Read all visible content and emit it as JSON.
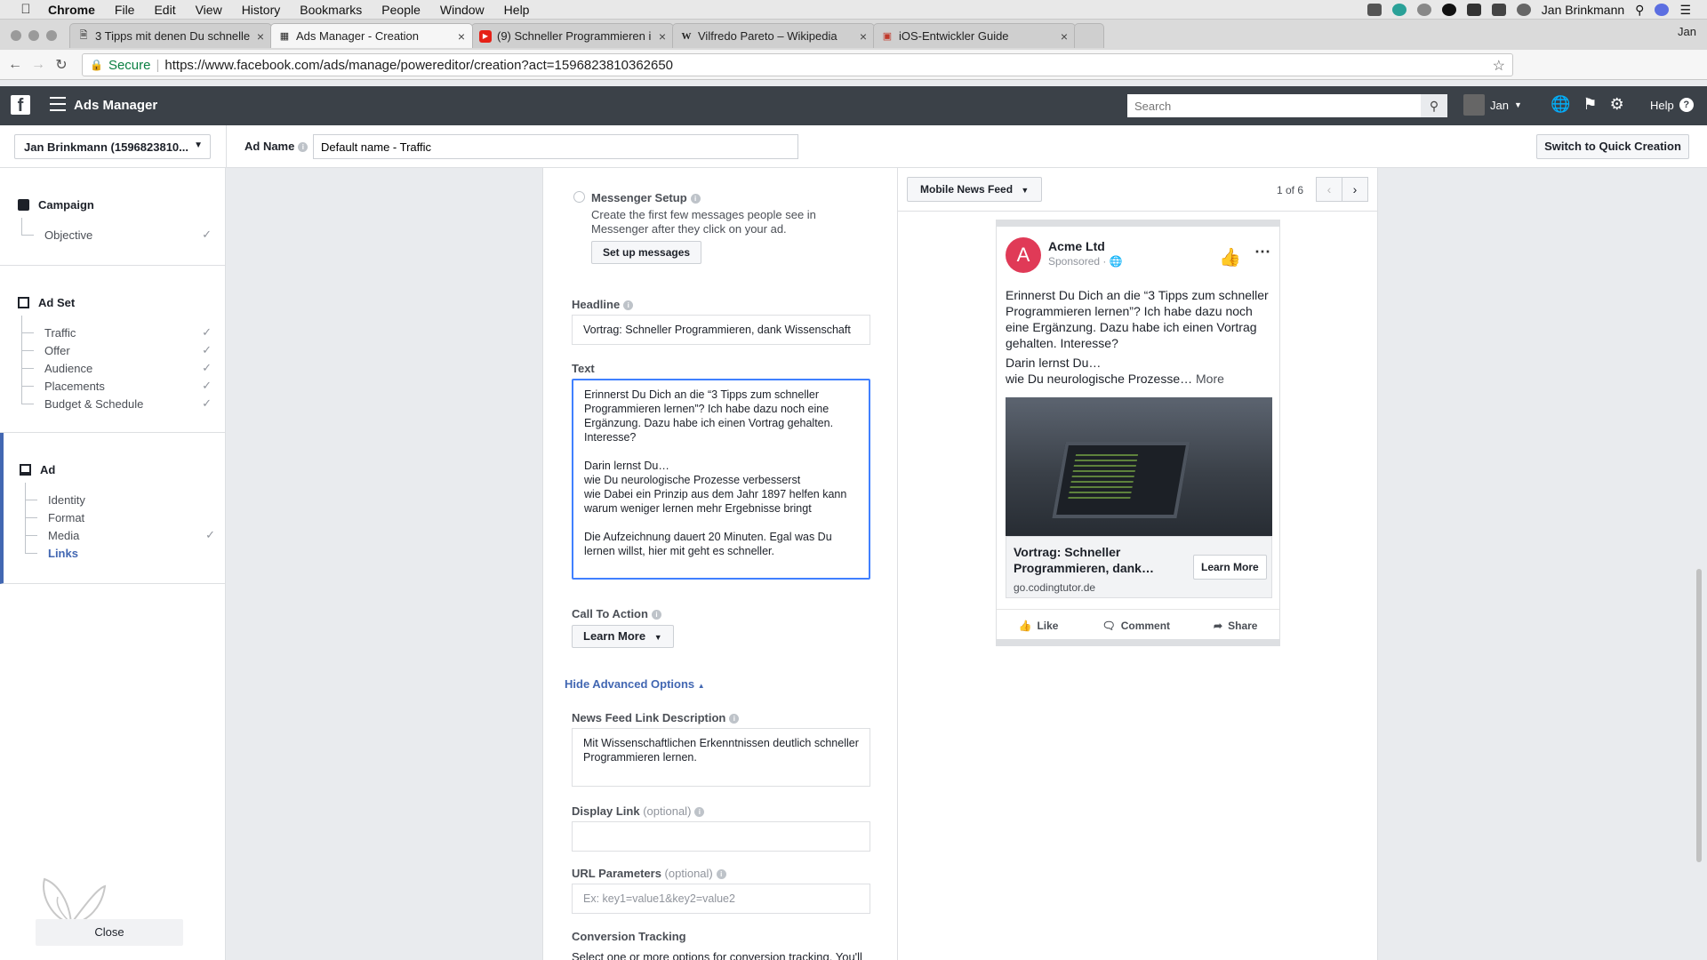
{
  "menubar": {
    "app": "Chrome",
    "items": [
      "File",
      "Edit",
      "View",
      "History",
      "Bookmarks",
      "People",
      "Window",
      "Help"
    ],
    "user": "Jan Brinkmann"
  },
  "browser": {
    "tabs": [
      {
        "title": "3 Tipps mit denen Du schnelle",
        "icon": "document-icon"
      },
      {
        "title": "Ads Manager - Creation",
        "icon": "ads-manager-icon"
      },
      {
        "title": "(9) Schneller Programmieren i",
        "icon": "youtube-icon"
      },
      {
        "title": "Vilfredo Pareto – Wikipedia",
        "icon": "wikipedia-icon"
      },
      {
        "title": "iOS-Entwickler Guide",
        "icon": "guide-icon"
      }
    ],
    "profile": "Jan",
    "secure_label": "Secure",
    "url": "https://www.facebook.com/ads/manage/powereditor/creation?act=1596823810362650"
  },
  "fb": {
    "title": "Ads Manager",
    "search_placeholder": "Search",
    "user": "Jan",
    "help": "Help"
  },
  "header": {
    "account": "Jan Brinkmann (1596823810...",
    "ad_name_label": "Ad Name",
    "ad_name_value": "Default name - Traffic",
    "quick_creation": "Switch to Quick Creation"
  },
  "sidebar": {
    "campaign": {
      "title": "Campaign",
      "items": [
        "Objective"
      ]
    },
    "adset": {
      "title": "Ad Set",
      "items": [
        "Traffic",
        "Offer",
        "Audience",
        "Placements",
        "Budget & Schedule"
      ]
    },
    "ad": {
      "title": "Ad",
      "items": [
        "Identity",
        "Format",
        "Media",
        "Links"
      ]
    },
    "close": "Close"
  },
  "form": {
    "messenger_title": "Messenger Setup",
    "messenger_desc": "Create the first few messages people see in Messenger after they click on your ad.",
    "setup_button": "Set up messages",
    "headline_label": "Headline",
    "headline_value": "Vortrag: Schneller Programmieren, dank Wissenschaft",
    "text_label": "Text",
    "text_value": "Erinnerst Du Dich an die “3 Tipps zum schneller Programmieren lernen”? Ich habe dazu noch eine Ergänzung. Dazu habe ich einen Vortrag gehalten. Interesse?\n\nDarin lernst Du…\nwie Du neurologische Prozesse verbesserst\nwie Dabei ein Prinzip aus dem Jahr 1897 helfen kann\nwarum weniger lernen mehr Ergebnisse bringt\n\nDie Aufzeichnung dauert 20 Minuten. Egal was Du lernen willst, hier mit geht es schneller.",
    "cta_label": "Call To Action",
    "cta_value": "Learn More",
    "hide_advanced": "Hide Advanced Options",
    "nf_desc_label": "News Feed Link Description",
    "nf_desc_value": "Mit Wissenschaftlichen Erkenntnissen deutlich schneller Programmieren lernen.",
    "display_link_label": "Display Link",
    "optional": "(optional)",
    "url_params_label": "URL Parameters",
    "url_params_placeholder": "Ex: key1=value1&key2=value2",
    "conversion_label": "Conversion Tracking",
    "conversion_desc": "Select one or more options for conversion tracking. You'll"
  },
  "preview": {
    "placement": "Mobile News Feed",
    "pager": "1 of 6",
    "page_name": "Acme Ltd",
    "avatar_letter": "A",
    "sponsored": "Sponsored · ",
    "text_1": "Erinnerst Du Dich an die “3 Tipps zum schneller Programmieren lernen”? Ich habe dazu noch eine Ergänzung. Dazu habe ich einen Vortrag gehalten. Interesse?",
    "text_2": "Darin lernst Du…",
    "text_3": "wie Du neurologische Prozesse…",
    "more": "More",
    "headline": "Vortrag: Schneller Programmieren, dank…",
    "domain": "go.codingtutor.de",
    "cta": "Learn More",
    "like": "Like",
    "comment": "Comment",
    "share": "Share"
  },
  "colors": {
    "fb_blue": "#4267b2",
    "focus_blue": "#4080ff",
    "topbar": "#3b4148",
    "avatar": "#e03a57"
  }
}
